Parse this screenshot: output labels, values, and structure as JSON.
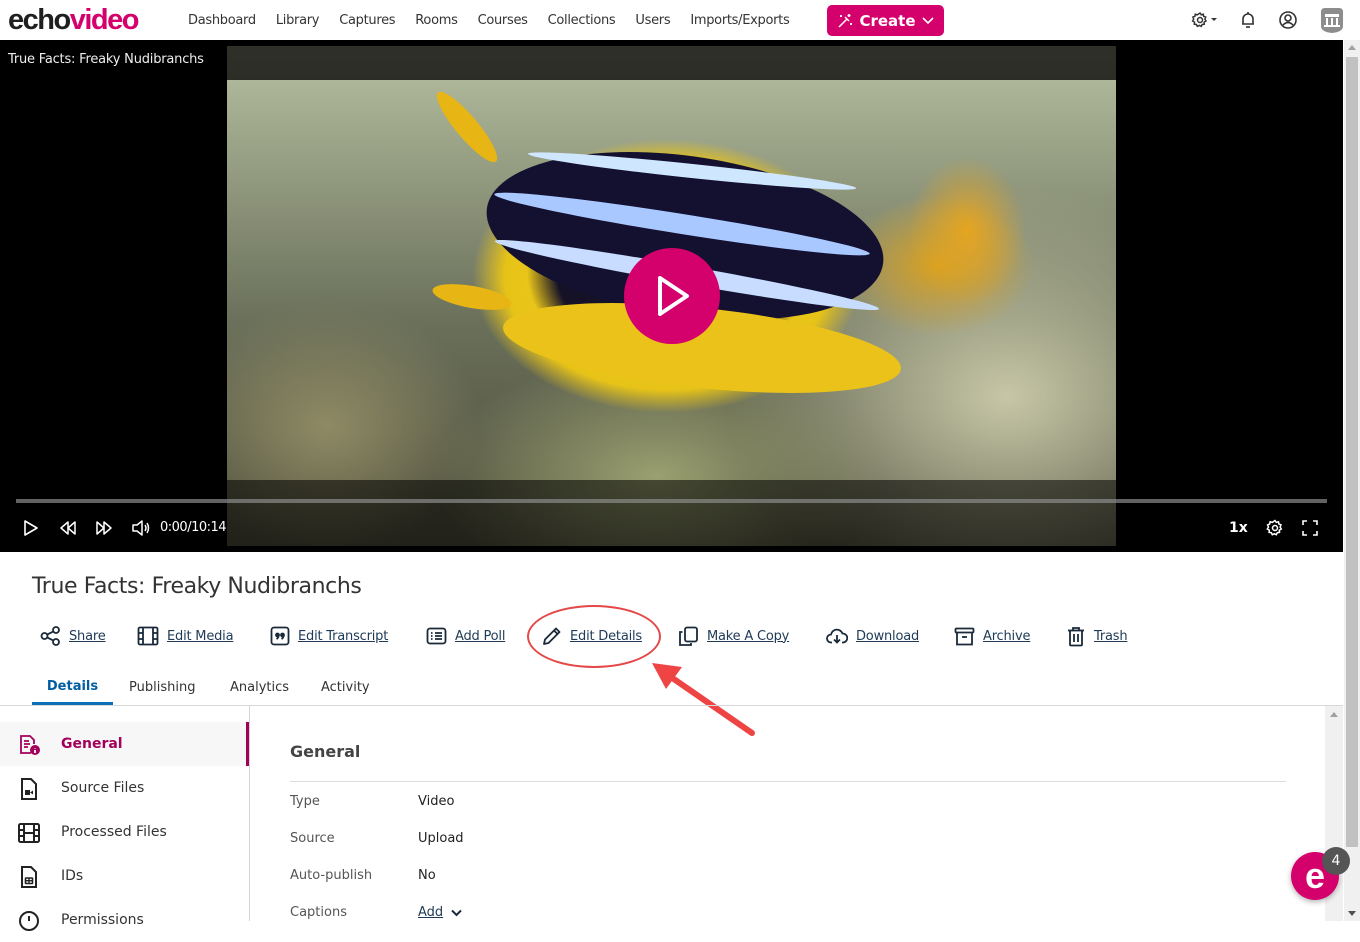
{
  "app": {
    "logo_part1": "echo",
    "logo_part2": "video",
    "brand_color": "#d4006b"
  },
  "nav": {
    "links": [
      "Dashboard",
      "Library",
      "Captures",
      "Rooms",
      "Courses",
      "Collections",
      "Users",
      "Imports/Exports"
    ],
    "create_label": "Create",
    "icons": [
      "settings-icon",
      "notifications-icon",
      "account-icon",
      "institution-icon"
    ]
  },
  "player": {
    "title": "True Facts: Freaky Nudibranchs",
    "time": "0:00/10:14",
    "speed": "1x",
    "progress_fraction": 0.0
  },
  "media": {
    "title": "True Facts: Freaky Nudibranchs",
    "actions": [
      "Share",
      "Edit Media",
      "Edit Transcript",
      "Add Poll",
      "Edit Details",
      "Make A Copy",
      "Download",
      "Archive",
      "Trash"
    ],
    "highlighted_action": "Edit Details"
  },
  "tabs": {
    "items": [
      "Details",
      "Publishing",
      "Analytics",
      "Activity"
    ],
    "active": "Details"
  },
  "sidebar": {
    "items": [
      "General",
      "Source Files",
      "Processed Files",
      "IDs",
      "Permissions"
    ],
    "active": "General"
  },
  "general": {
    "title": "General",
    "fields": [
      {
        "label": "Type",
        "value": "Video"
      },
      {
        "label": "Source",
        "value": "Upload"
      },
      {
        "label": "Auto-publish",
        "value": "No"
      },
      {
        "label": "Captions",
        "value": "Add"
      }
    ]
  },
  "fab": {
    "letter": "e",
    "badge_count": "4"
  }
}
